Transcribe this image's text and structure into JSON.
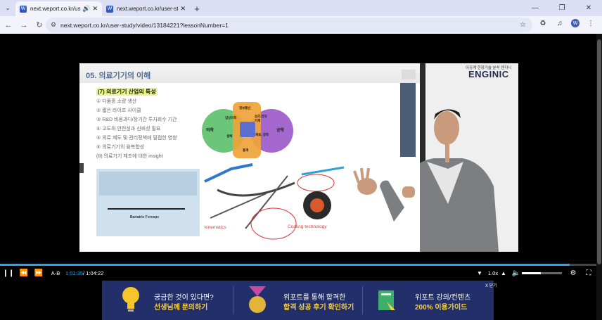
{
  "browser": {
    "tabs": [
      {
        "title": "next.weport.co.kr/user-stu",
        "active": true
      },
      {
        "title": "next.weport.co.kr/user-study/",
        "active": false
      }
    ],
    "favicon_letter": "W",
    "url": "next.weport.co.kr/user-study/video/13184221?lessonNumber=1",
    "profile_letter": "W"
  },
  "slide": {
    "title": "05. 의료기기의 이해",
    "section_heading": "(7) 의료기기 산업의 특성",
    "bullets": [
      "① 다품종 소량 생산",
      "② 짧은 라이프 사이클",
      "③ R&D 비용과다/장기간 투자회수 기간",
      "④ 고도의 안전성과 신뢰성 필요",
      "⑤ 의료 제도 및 관리정책에 밀접한 영향",
      "⑥ 의료기기의 융복합성",
      "(8) 의료기기 제조에 대한 insight"
    ],
    "venn_labels": {
      "left": "의학",
      "right": "공학",
      "top": "정보통신",
      "mid_left": "임상의학",
      "mid_right": "전기,전자 기계",
      "center": "재료, 광학",
      "bottom_left": "생체",
      "bottom": "통계"
    },
    "photo_caption": "Bariatric Forceps",
    "device_labels": {
      "kinematics": "kinematics",
      "coating": "Coating technology"
    }
  },
  "brand": {
    "tagline": "이공계 현장기술 분석 엔지니",
    "name": "ENGINIC"
  },
  "player": {
    "progress_pct": 95.5,
    "ab_label": "A-B",
    "current_time": "1:01:35",
    "total_time": "/ 1:04:22",
    "speed": "1.0x",
    "volume_pct": 48
  },
  "banner": {
    "close_label": "X 닫기",
    "items": [
      {
        "line1": "궁금한 것이 있다면?",
        "line2": "선생님께 문의하기"
      },
      {
        "line1": "위포트를 통해 합격한",
        "line2": "합격 성공 후기 확인하기"
      },
      {
        "line1": "위포트 강의/컨텐츠",
        "line2": "200% 이용가이드"
      }
    ]
  }
}
